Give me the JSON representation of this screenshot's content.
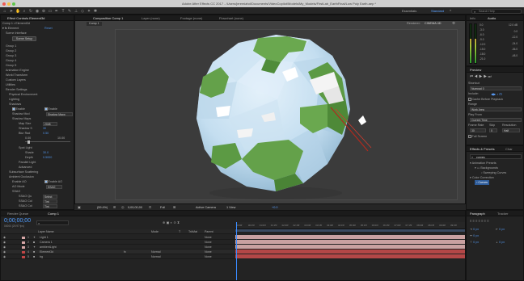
{
  "window": {
    "title": "Adobe After Effects CC 2017 - /Users/jeremiahd/Documents/VideoCopilot/Models/My_Models/FirstLab_EarthFinal/Low Poly Earth.aep *"
  },
  "toolbar": {
    "workspaces": [
      "Essentials",
      "Standard"
    ],
    "search_placeholder": "Search Help"
  },
  "effect_controls": {
    "tab_label": "Effect Controls Element3d",
    "layer_label": "Comp 1 • Element3d",
    "effect_name": "Element",
    "reset_label": "Reset",
    "scene_interface_label": "Scene Interface",
    "scene_setup_button": "Scene Setup",
    "groups": [
      "Group 1",
      "Group 2",
      "Group 3",
      "Group 4",
      "Group 5"
    ],
    "sections": [
      "Animation Engine",
      "World Transform",
      "Custom Layers",
      "Utilities",
      "Render Settings",
      "Physical Environment",
      "Lighting",
      "Shadows"
    ],
    "enable_label": "Enable",
    "shadow_mode_label": "Shadow Mod",
    "shadow_mode_value": "Shadow Mapp",
    "shadow_maps_label": "Shadow Maps",
    "map_size_label": "Map Size",
    "map_size_value": "2048",
    "shadow_s_label": "Shadow S",
    "shadow_s_value": "30",
    "blur_rad_label": "Blur Rad",
    "blur_rad_value": "0.50",
    "range_min": "0.00",
    "range_max": "10.00",
    "spot_light_label": "Spot Light",
    "shade_label": "Shade",
    "shade_value": "30.0",
    "depth_label": "Depth",
    "depth_value": "0.5000",
    "parallel_light_label": "Parallel Light",
    "advanced_label": "Advanced",
    "subsurface_label": "Subsurface Scattering",
    "ambient_occlusion_label": "Ambient Occlusion",
    "enable_ao_label": "Enable AO",
    "enable_ao2_label": "Enable AO",
    "ao_mode_label": "AO Mode",
    "ao_mode_value": "SSAO",
    "ssao_label": "SSAO",
    "ssao_rows": [
      {
        "label": "SSAO Qu",
        "value": "Select"
      },
      {
        "label": "SSAO Col",
        "value": "Tint"
      },
      {
        "label": "SSAO Col",
        "value": "Tint"
      },
      {
        "label": "SSAO Inte",
        "value": "1.0"
      },
      {
        "label": "SSAO Sa",
        "value": "8"
      }
    ]
  },
  "composition": {
    "tab_label": "Composition Comp 1",
    "other_tabs": [
      "Layer (none)",
      "Footage (none)",
      "Flowchart (none)"
    ],
    "comp_name": "Comp 1",
    "renderer_label": "Renderer:",
    "renderer_value": "CINEMA 4D",
    "footer": {
      "zoom": "(59.4%)",
      "timecode": "0;00;00;00",
      "resolution": "Full",
      "camera": "Active Camera",
      "views": "1 View",
      "exposure": "+0.0"
    }
  },
  "info_panel": {
    "tabs": [
      "Info",
      "Audio"
    ],
    "audio_levels": [
      "0.0",
      "-3.0",
      "-6.0",
      "-9.0",
      "-12.0",
      "-15.0",
      "-18.0",
      "-21.0"
    ],
    "audio_db": [
      "12.0 dB",
      "0.0",
      "-12.0",
      "-24.0",
      "-36.0",
      "-48.0"
    ]
  },
  "preview_panel": {
    "title": "Preview",
    "shortcut_label": "Shortcut",
    "shortcut_value": "Numpad 0",
    "include_label": "Include:",
    "cache_label": "Cache Before Playback",
    "range_label": "Range",
    "range_value": "Work Area",
    "play_from_label": "Play From",
    "play_from_value": "Current Time",
    "frame_rate_label": "Frame Rate",
    "skip_label": "Skip",
    "resolution_label": "Resolution",
    "frame_rate_value": "30",
    "skip_value": "0",
    "resolution_value": "Half",
    "full_screen_label": "Full Screen"
  },
  "effects_presets": {
    "tabs": [
      "Effects & Presets",
      "Char"
    ],
    "search_value": "curves",
    "items": [
      "Animation Presets",
      "Backgrounds",
      "Sweeping Curves",
      "Color Correction",
      "Curves"
    ]
  },
  "timeline": {
    "tabs": [
      "Render Queue",
      "Comp 1"
    ],
    "timecode": "0;00;00;00",
    "fps": "00000 (29.97 fps)",
    "columns": [
      "Layer Name",
      "Mode",
      "T",
      "TrkMat",
      "Parent"
    ],
    "layers": [
      {
        "num": "1",
        "name": "Light 1",
        "mode": "",
        "parent": "None",
        "color": "#d7a6a6"
      },
      {
        "num": "2",
        "name": "Camera 1",
        "mode": "",
        "parent": "None",
        "color": "#d7a6a6"
      },
      {
        "num": "3",
        "name": "ambientLight",
        "mode": "",
        "parent": "None",
        "color": "#d7a6a6"
      },
      {
        "num": "4",
        "name": "Element3d",
        "mode": "Normal",
        "parent": "None",
        "color": "#c04646"
      },
      {
        "num": "5",
        "name": "bg",
        "mode": "Normal",
        "parent": "None",
        "color": "#c04646"
      }
    ],
    "ruler_marks": [
      "0:00f",
      "00:15f",
      "01:00f",
      "01:15f",
      "02:00f",
      "02:15f",
      "03:00f",
      "03:15f",
      "04:00f",
      "04:15f",
      "05:00f",
      "05:15f",
      "06:00f",
      "06:15f",
      "07:00f",
      "07:15f",
      "08:00f",
      "08:15f",
      "09:00f",
      "09:15f"
    ]
  },
  "paragraph_panel": {
    "tabs": [
      "Paragraph",
      "Tracker"
    ],
    "values": [
      "0 px",
      "0 px",
      "0 px",
      "0 px",
      "0 px"
    ]
  },
  "colors": {
    "accent_blue": "#2d8ceb",
    "globe_ocean": "#cde4f3",
    "globe_land": "#64a14a",
    "layer_red": "#c04646",
    "layer_pink": "#d7a6a6"
  }
}
